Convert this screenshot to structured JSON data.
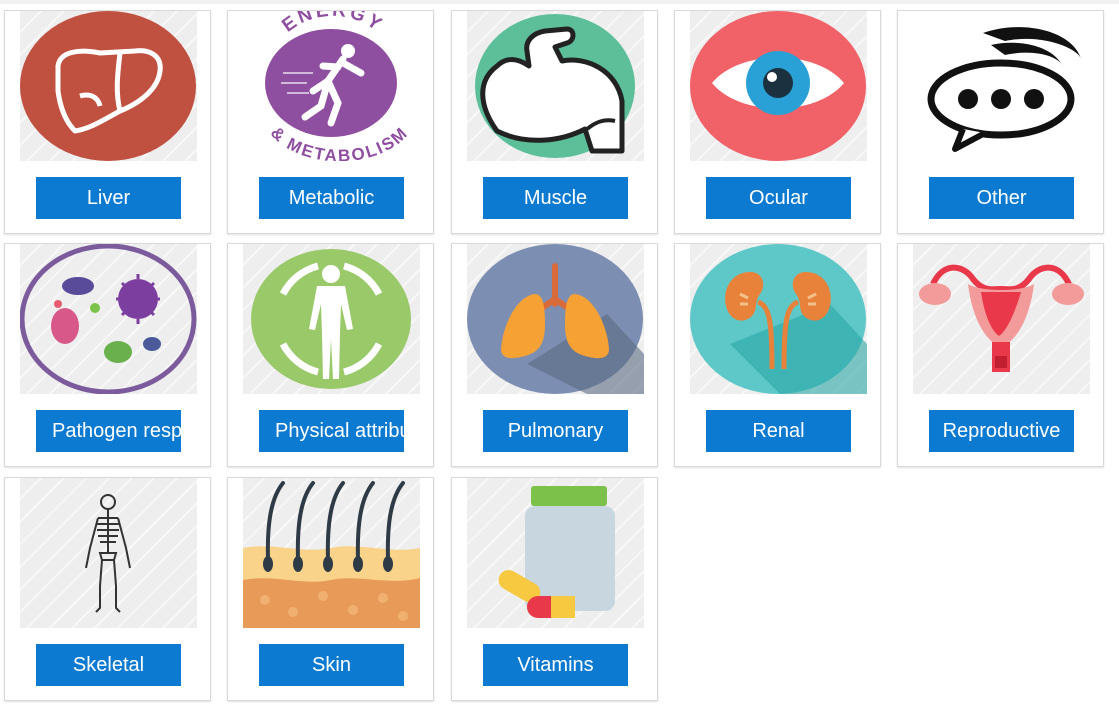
{
  "categories": [
    {
      "label": "Liver",
      "icon": "liver-icon"
    },
    {
      "label": "Metabolic",
      "icon": "energy-metabolism-icon",
      "icon_text_top": "ENERGY",
      "icon_text_bottom": "& METABOLISM"
    },
    {
      "label": "Muscle",
      "icon": "flexed-arm-icon"
    },
    {
      "label": "Ocular",
      "icon": "eye-icon"
    },
    {
      "label": "Other",
      "icon": "speech-bubble-icon"
    },
    {
      "label": "Pathogen response",
      "icon": "pathogen-icon"
    },
    {
      "label": "Physical attributes",
      "icon": "human-body-icon"
    },
    {
      "label": "Pulmonary",
      "icon": "lungs-icon"
    },
    {
      "label": "Renal",
      "icon": "kidneys-icon"
    },
    {
      "label": "Reproductive",
      "icon": "uterus-icon"
    },
    {
      "label": "Skeletal",
      "icon": "skeleton-icon"
    },
    {
      "label": "Skin",
      "icon": "skin-hair-icon"
    },
    {
      "label": "Vitamins",
      "icon": "vitamin-bottle-icon"
    }
  ],
  "colors": {
    "button": "#0d7ad1",
    "button_text": "#ffffff"
  }
}
